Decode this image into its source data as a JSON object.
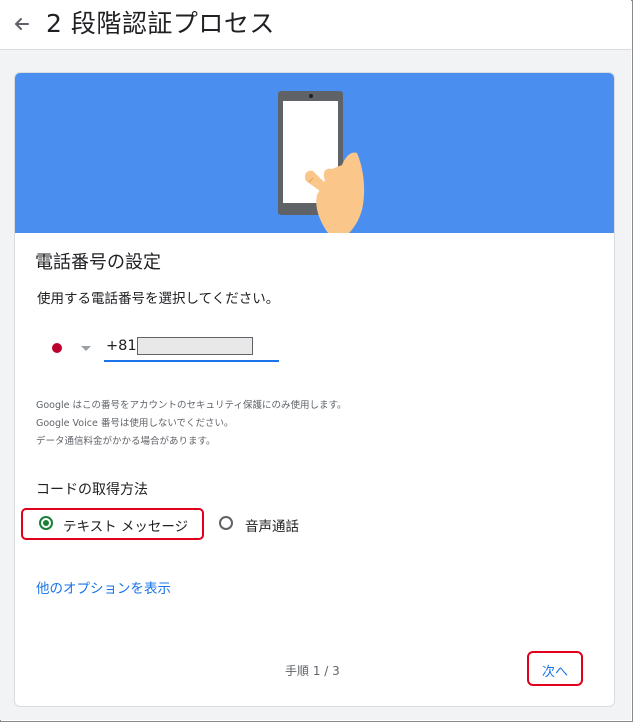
{
  "header": {
    "back_icon": "arrow-back-icon",
    "title": "2 段階認証プロセス"
  },
  "banner": {
    "background_color": "#4a8ef0",
    "illustration": "phone-in-hand-icon"
  },
  "phone_setup": {
    "title": "電話番号の設定",
    "description": "使用する電話番号を選択してください。",
    "country_flag": "japan-flag-icon",
    "country_code": "+81",
    "phone_value": "",
    "notice_lines": [
      "Google はこの番号をアカウントのセキュリティ保護にのみ使用します。",
      "Google Voice 番号は使用しないでください。",
      "データ通信料金がかかる場合があります。"
    ]
  },
  "code_method": {
    "title": "コードの取得方法",
    "options": [
      {
        "label": "テキスト メッセージ",
        "selected": true
      },
      {
        "label": "音声通話",
        "selected": false
      }
    ]
  },
  "more_options_link": "他のオプションを表示",
  "footer": {
    "step": "手順 1 / 3",
    "next_label": "次へ"
  },
  "colors": {
    "accent": "#1a73e8",
    "radio_selected": "#188038",
    "highlight": "#e0001b"
  }
}
